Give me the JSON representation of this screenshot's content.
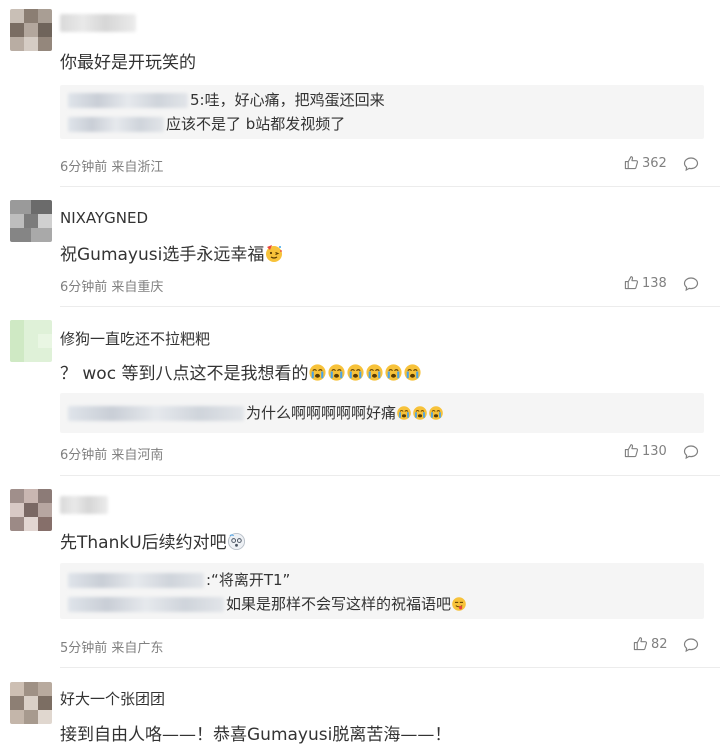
{
  "comments": [
    {
      "text": "你最好是开玩笑的",
      "quote": {
        "line1_text": "5:哇，好心痛，把鸡蛋还回来",
        "line2_text": "应该不是了 b站都发视频了"
      },
      "time": "6分钟前",
      "location": "来自浙江",
      "likes": "362"
    },
    {
      "username": "NIXAYGNED",
      "text": "祝Gumayusi选手永远幸福",
      "time": "6分钟前",
      "location": "来自重庆",
      "likes": "138"
    },
    {
      "username": "修狗一直吃还不拉粑粑",
      "text": "？ woc 等到八点这不是我想看的",
      "quote": {
        "line1_text": "为什么啊啊啊啊啊好痛"
      },
      "time": "6分钟前",
      "location": "来自河南",
      "likes": "130"
    },
    {
      "text": "先ThankU后续约对吧",
      "quote": {
        "line1_text": ":“将离开T1”",
        "line2_text": "如果是那样不会写这样的祝福语吧"
      },
      "time": "5分钟前",
      "location": "来自广东",
      "likes": "82"
    },
    {
      "username": "好大一个张团团",
      "text": "接到自由人咯——！恭喜Gumayusi脱离苦海——！"
    }
  ],
  "icons": {
    "like": "thumbs-up-icon",
    "reply": "comment-bubble-icon",
    "emoji_cry": "crying-face-emoji",
    "emoji_party": "party-face-emoji",
    "emoji_dizzy": "dizzy-face-emoji",
    "emoji_tongue": "tongue-face-emoji"
  },
  "colors": {
    "text": "#333333",
    "meta": "#808080",
    "quote_bg": "#f5f5f5",
    "divider": "#ececec"
  }
}
